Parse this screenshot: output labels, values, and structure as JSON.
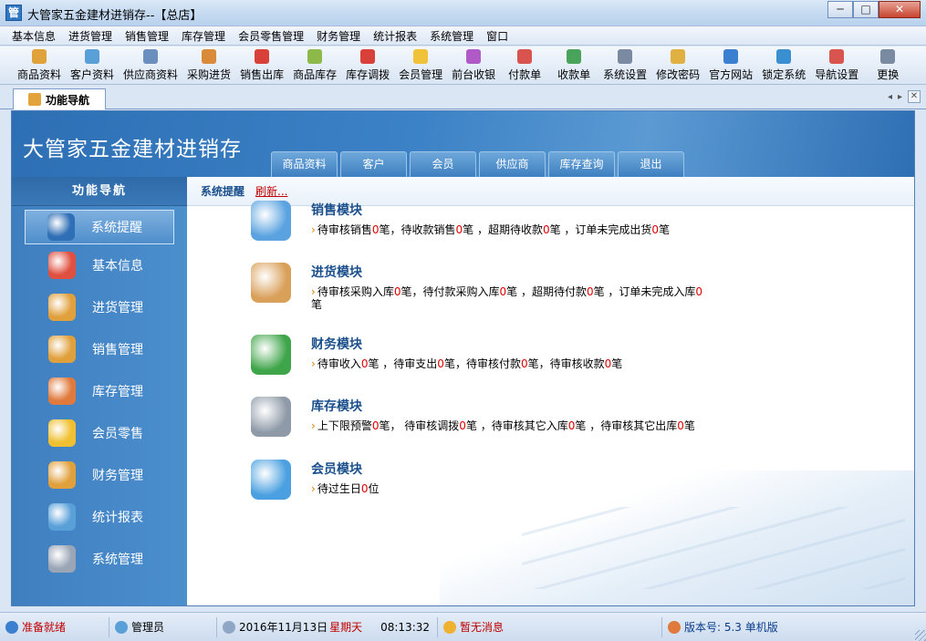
{
  "window": {
    "title": "大管家五金建材进销存--【总店】",
    "app_icon": "管",
    "minimize_glyph": "─",
    "maximize_glyph": "□",
    "close_glyph": "✕"
  },
  "menu": [
    "基本信息",
    "进货管理",
    "销售管理",
    "库存管理",
    "会员零售管理",
    "财务管理",
    "统计报表",
    "系统管理",
    "窗口"
  ],
  "toolbar": [
    {
      "label": "商品资料",
      "icon": "box-icon",
      "color": "#e0a33c"
    },
    {
      "label": "客户资料",
      "icon": "customer-icon",
      "color": "#5aa0d8"
    },
    {
      "label": "供应商资料",
      "icon": "supplier-icon",
      "color": "#6a8fbf"
    },
    {
      "label": "采购进货",
      "icon": "truck-icon",
      "color": "#d98b3a"
    },
    {
      "label": "销售出库",
      "icon": "cart-icon",
      "color": "#d9403a"
    },
    {
      "label": "商品库存",
      "icon": "warehouse-icon",
      "color": "#8cb94a"
    },
    {
      "label": "库存调拨",
      "icon": "transfer-icon",
      "color": "#d9403a"
    },
    {
      "label": "会员管理",
      "icon": "member-icon",
      "color": "#f0c23a"
    },
    {
      "label": "前台收银",
      "icon": "cashier-icon",
      "color": "#b05ac8"
    },
    {
      "label": "付款单",
      "icon": "payment-icon",
      "color": "#d9534f"
    },
    {
      "label": "收款单",
      "icon": "receipt-icon",
      "color": "#4aa35a"
    },
    {
      "label": "系统设置",
      "icon": "settings-icon",
      "color": "#7a8aa0"
    },
    {
      "label": "修改密码",
      "icon": "key-icon",
      "color": "#e0b040"
    },
    {
      "label": "官方网站",
      "icon": "browser-icon",
      "color": "#3a7fd0"
    },
    {
      "label": "锁定系统",
      "icon": "lock-icon",
      "color": "#3a8fd0"
    },
    {
      "label": "导航设置",
      "icon": "navigation-icon",
      "color": "#d9534f"
    },
    {
      "label": "更换",
      "icon": "switch-icon",
      "color": "#7a8aa0"
    }
  ],
  "doc_tab": {
    "label": "功能导航"
  },
  "tab_controls": {
    "prev": "◂",
    "next": "▸",
    "close": "✕"
  },
  "banner": {
    "title": "大管家五金建材进销存",
    "tabs": [
      "商品资料",
      "客户",
      "会员",
      "供应商",
      "库存查询",
      "退出"
    ]
  },
  "sidebar": {
    "heading": "功能导航",
    "items": [
      {
        "label": "系统提醒",
        "icon": "info-icon",
        "color": "#2f6fb5",
        "active": true
      },
      {
        "label": "基本信息",
        "icon": "cubes-icon",
        "color": "#e05040"
      },
      {
        "label": "进货管理",
        "icon": "box-in-icon",
        "color": "#e0a03c"
      },
      {
        "label": "销售管理",
        "icon": "box-out-icon",
        "color": "#e0a03c"
      },
      {
        "label": "库存管理",
        "icon": "house-icon",
        "color": "#e07a3c"
      },
      {
        "label": "会员零售",
        "icon": "chat-icon",
        "color": "#f0c030"
      },
      {
        "label": "财务管理",
        "icon": "finance-icon",
        "color": "#e0a03c"
      },
      {
        "label": "统计报表",
        "icon": "chart-icon",
        "color": "#5aa0d8"
      },
      {
        "label": "系统管理",
        "icon": "gears-icon",
        "color": "#9aa6b6"
      }
    ]
  },
  "content": {
    "breadcrumb": "系统提醒",
    "refresh": "刷新...",
    "modules": [
      {
        "title": "销售模块",
        "icon": "book-icon",
        "color": "#5aa3e0",
        "parts": [
          "待审核销售",
          "0",
          "笔，待收款销售",
          "0",
          "笔 ，超期待收款",
          "0",
          "笔 ，订单未完成出货",
          "0",
          "笔"
        ]
      },
      {
        "title": "进货模块",
        "icon": "box-arrow-icon",
        "color": "#d9a05a",
        "parts": [
          "待审核采购入库",
          "0",
          "笔，待付款采购入库",
          "0",
          "笔 ，超期待付款",
          "0",
          "笔 ，订单未完成入库",
          "0",
          "笔"
        ]
      },
      {
        "title": "财务模块",
        "icon": "dollar-icon",
        "color": "#3fa54a",
        "parts": [
          "待审收入",
          "0",
          "笔 ，待审支出",
          "0",
          "笔，待审核付款",
          "0",
          "笔，待审核收款",
          "0",
          "笔"
        ]
      },
      {
        "title": "库存模块",
        "icon": "database-icon",
        "color": "#8f9aa8",
        "parts": [
          "上下限预警",
          "0",
          "笔，  待审核调拨",
          "0",
          "笔 ，待审核其它入库",
          "0",
          "笔 ，待审核其它出库",
          "0",
          "笔"
        ]
      },
      {
        "title": "会员模块",
        "icon": "chat-bubbles-icon",
        "color": "#4aa0e0",
        "parts": [
          "待过生日",
          "0",
          "位"
        ]
      }
    ]
  },
  "statusbar": {
    "ready": "准备就绪",
    "user": "管理员",
    "date": "2016年11月13日",
    "weekday": "星期天",
    "time": "08:13:32",
    "message": "暂无消息",
    "version": "版本号: 5.3 单机版"
  },
  "colors": {
    "accent": "#3c82c6",
    "alert": "#e00000"
  }
}
